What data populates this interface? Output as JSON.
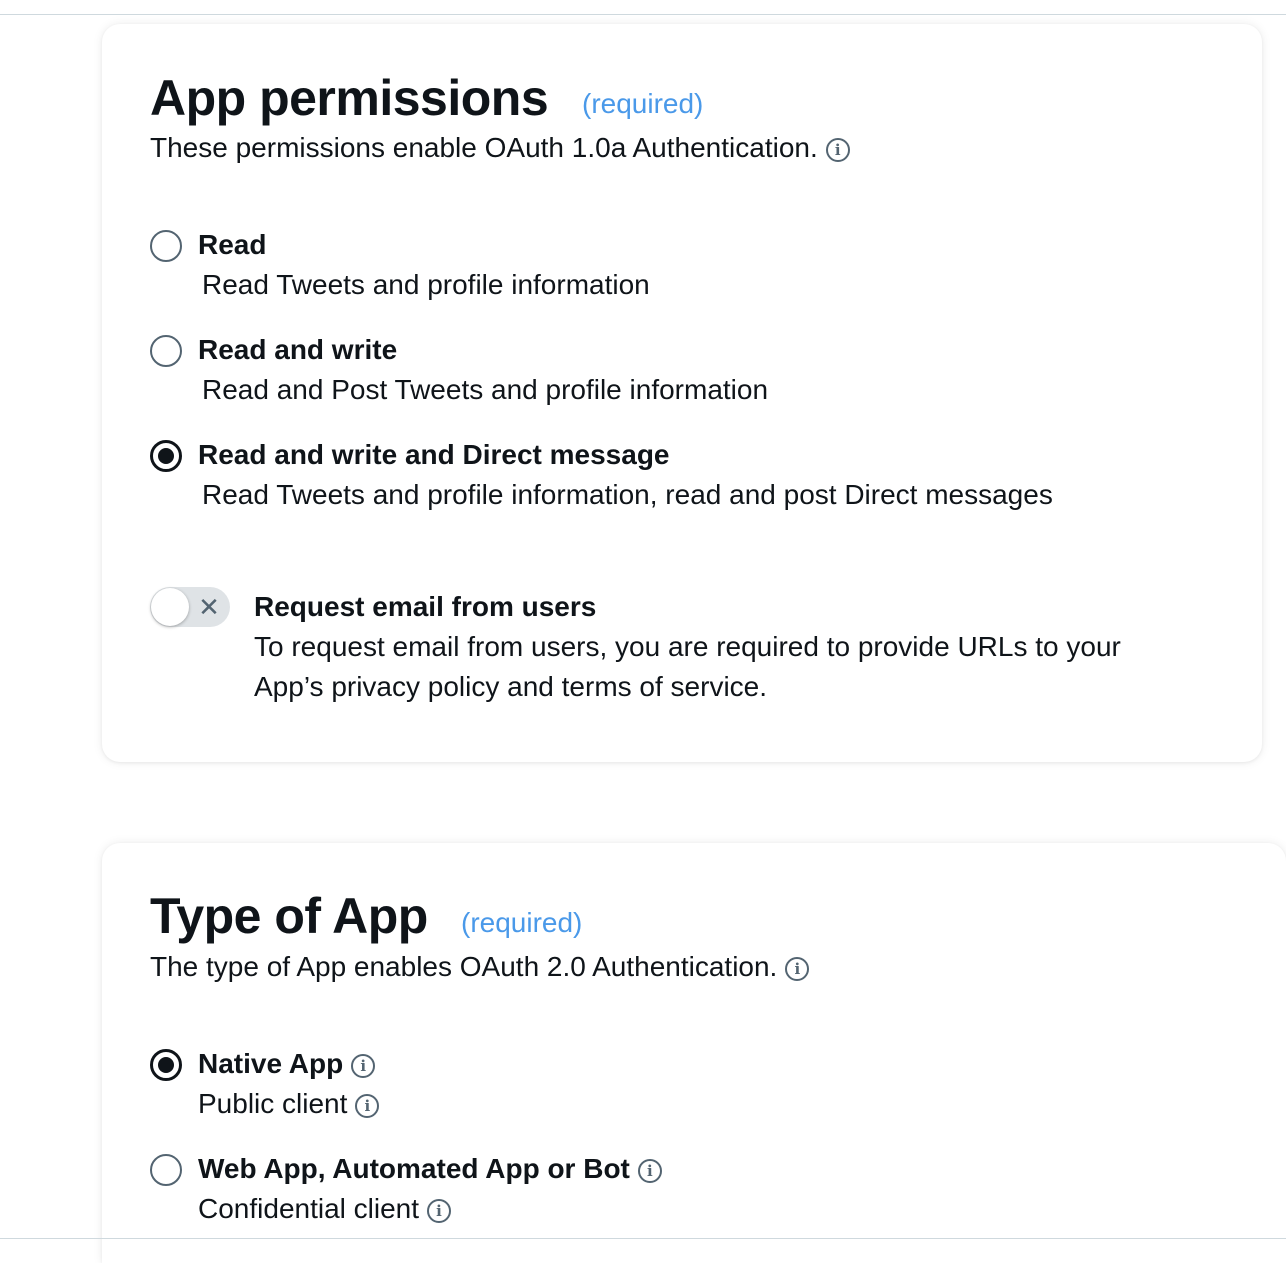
{
  "permissions": {
    "title": "App permissions",
    "required": "(required)",
    "description": "These permissions enable OAuth 1.0a Authentication.",
    "options": [
      {
        "label": "Read",
        "sub": "Read Tweets and profile information",
        "checked": false
      },
      {
        "label": "Read and write",
        "sub": "Read and Post Tweets and profile information",
        "checked": false
      },
      {
        "label": "Read and write and Direct message",
        "sub": "Read Tweets and profile information, read and post Direct messages",
        "checked": true
      }
    ],
    "email": {
      "label": "Request email from users",
      "line1": "To request email from users, you are required to provide URLs to your",
      "line2": "App’s privacy policy and terms of service.",
      "enabled": false
    }
  },
  "app_type": {
    "title": "Type of App",
    "required": "(required)",
    "description": "The type of App enables OAuth 2.0 Authentication.",
    "options": [
      {
        "label": "Native App",
        "sub": "Public client",
        "checked": true
      },
      {
        "label": "Web App, Automated App or Bot",
        "sub": "Confidential client",
        "checked": false
      }
    ]
  },
  "icons": {
    "info": "i",
    "toggle_off": "✕"
  },
  "colors": {
    "accent": "#4a99e9",
    "text": "#0f1419",
    "muted": "#536471"
  }
}
